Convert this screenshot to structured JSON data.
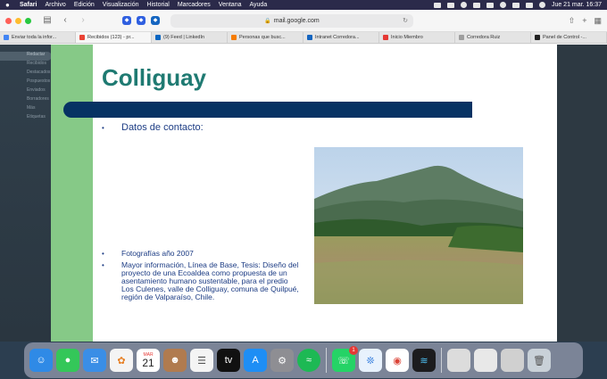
{
  "menubar": {
    "apple": "",
    "items": [
      "Safari",
      "Archivo",
      "Edición",
      "Visualización",
      "Historial",
      "Marcadores",
      "Ventana",
      "Ayuda"
    ],
    "datetime": "Jue 21 mar.  16:37"
  },
  "browser": {
    "url": "mail.google.com",
    "tabs": [
      {
        "label": "Enviar toda la infor...",
        "favicon_color": "#4285f4"
      },
      {
        "label": "Recibidos (123) - pr...",
        "favicon_color": "#ea4335"
      },
      {
        "label": "(9) Feed | LinkedIn",
        "favicon_color": "#0a66c2"
      },
      {
        "label": "Personas que busc...",
        "favicon_color": "#f57c00"
      },
      {
        "label": "Intranet Corredora...",
        "favicon_color": "#1565c0"
      },
      {
        "label": "Inicio Miembro",
        "favicon_color": "#e53935"
      },
      {
        "label": "Corredora Ruiz",
        "favicon_color": "#9e9e9e"
      },
      {
        "label": "Panel de Control -...",
        "favicon_color": "#212121"
      }
    ]
  },
  "gmail_side": {
    "items": [
      "Redactar",
      "Recibidos",
      "Destacados",
      "Pospuestos",
      "Enviados",
      "Borradores",
      "Más",
      "Etiquetas"
    ]
  },
  "slide": {
    "title": "Colliguay",
    "contact_bullet": "Datos de contacto:",
    "photos_bullet": "Fotografías año 2007",
    "info_bullet": "Mayor información, Línea de Base, Tesis: Diseño del proyecto de una Ecoaldea como propuesta de un asentamiento humano sustentable, para el predio Los Culenes, valle de Colliguay, comuna de Quilpué, región de Valparaíso, Chile.",
    "bullet_symbol": "•"
  },
  "dock": {
    "calendar_month": "MAR",
    "calendar_day": "21",
    "whatsapp_badge": "1",
    "apps": [
      "finder-icon",
      "messages-icon",
      "mail-icon",
      "photos-icon",
      "calendar-icon",
      "contacts-icon",
      "reminders-icon",
      "appletv-icon",
      "appstore-icon",
      "settings-icon",
      "spotify-icon",
      "whatsapp-icon",
      "safari-icon",
      "chrome-icon",
      "voicememos-icon",
      "trash-icon"
    ]
  },
  "colors": {
    "title": "#1f7a72",
    "green_bar": "#86c987",
    "blue_bar": "#063263",
    "bullet_text": "#1c3c84"
  }
}
